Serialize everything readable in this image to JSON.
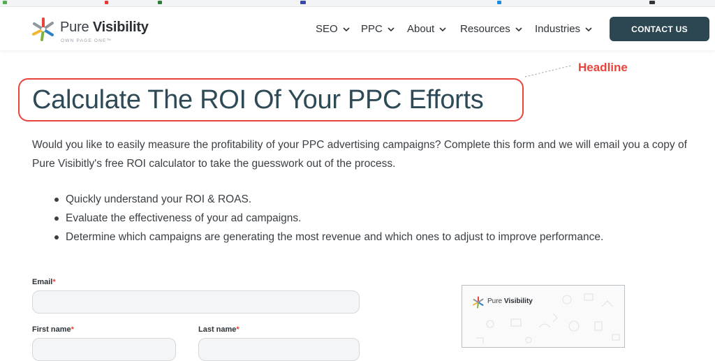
{
  "brand": {
    "name_regular": "Pure",
    "name_bold": "Visibility",
    "tagline": "OWN PAGE ONE™",
    "colors": {
      "red": "#e7453c",
      "green": "#7cb342",
      "blue": "#2f7fc1",
      "gray": "#8f979e",
      "yellow": "#f2b632"
    }
  },
  "nav": {
    "items": [
      {
        "label": "SEO"
      },
      {
        "label": "PPC"
      },
      {
        "label": "About"
      },
      {
        "label": "Resources"
      },
      {
        "label": "Industries"
      }
    ],
    "contact_label": "CONTACT US",
    "contact_color": "#2c4752"
  },
  "annotation": {
    "label": "Headline",
    "color": "#e7453c"
  },
  "hero": {
    "headline": "Calculate The ROI Of Your PPC Efforts",
    "intro": "Would you like to easily measure the profitability of your PPC advertising campaigns? Complete this form and we will email you a copy of Pure Visibitly's free ROI calculator to take the guesswork out of the process.",
    "bullets": [
      "Quickly understand your ROI & ROAS.",
      "Evaluate the effectiveness of your ad campaigns.",
      "Determine which campaigns are generating the most revenue and which ones to adjust to improve performance."
    ]
  },
  "form": {
    "email_label": "Email",
    "first_name_label": "First name",
    "last_name_label": "Last name",
    "required_mark": "*",
    "email_value": "",
    "first_name_value": "",
    "last_name_value": ""
  },
  "preview": {
    "name_regular": "Pure",
    "name_bold": "Visibility"
  }
}
